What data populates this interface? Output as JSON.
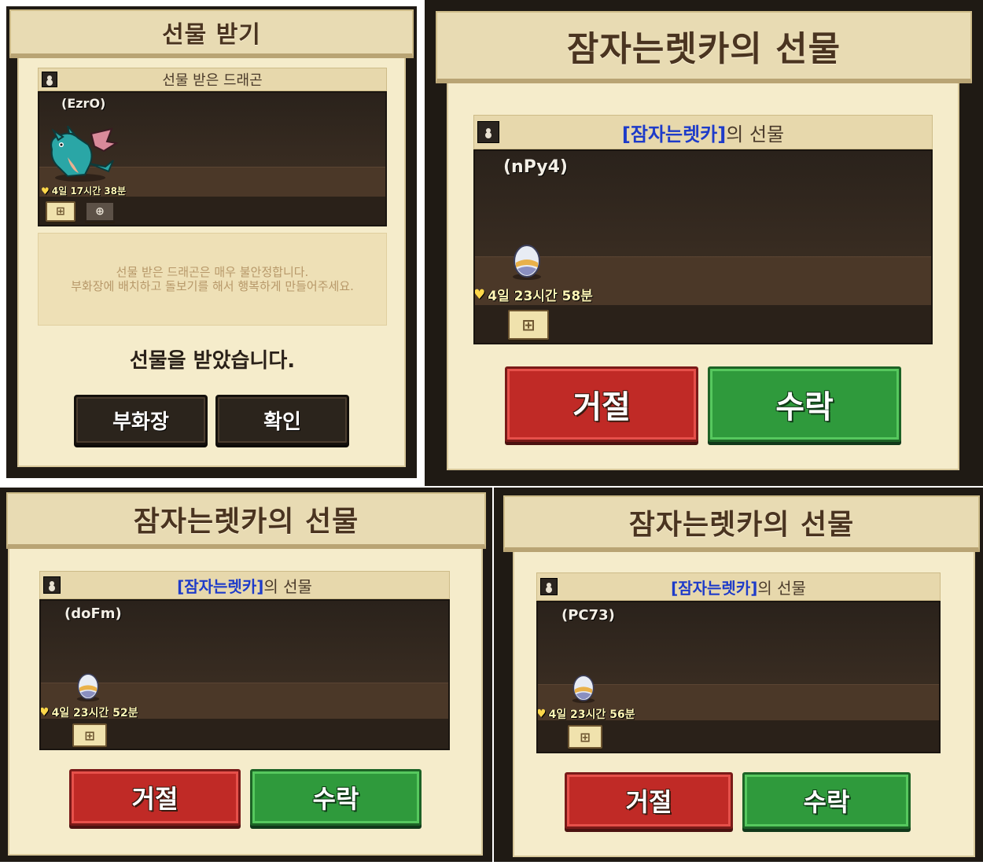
{
  "panels": {
    "receive": {
      "title": "선물 받기",
      "subheader": "선물 받은 드래곤",
      "tag": "(EzrO)",
      "timer": "4일 17시간 38분",
      "info_line1": "선물 받은 드래곤은 매우 불안정합니다.",
      "info_line2": "부화장에 배치하고 돌보기를 해서 행복하게 만들어주세요.",
      "message": "선물을 받았습니다.",
      "hatchery_label": "부화장",
      "confirm_label": "확인"
    },
    "gift1": {
      "title": "잠자는렛카의 선물",
      "sender": "[잠자는렛카]",
      "suffix": "의 선물",
      "tag": "(nPy4)",
      "timer": "4일 23시간 58분",
      "reject_label": "거절",
      "accept_label": "수락"
    },
    "gift2": {
      "title": "잠자는렛카의 선물",
      "sender": "[잠자는렛카]",
      "suffix": "의 선물",
      "tag": "(doFm)",
      "timer": "4일 23시간 52분",
      "reject_label": "거절",
      "accept_label": "수락"
    },
    "gift3": {
      "title": "잠자는렛카의 선물",
      "sender": "[잠자는렛카]",
      "suffix": "의 선물",
      "tag": "(PC73)",
      "timer": "4일 23시간 56분",
      "reject_label": "거절",
      "accept_label": "수락"
    }
  },
  "icons": {
    "heart": "heart-icon",
    "person": "person-icon",
    "nest": "nest-icon",
    "target": "target-icon",
    "egg": "egg-icon",
    "dragon": "dragon-icon"
  },
  "colors": {
    "sender_blue": "#1e3bc9",
    "reject_red": "#c02a26",
    "accept_green": "#2f9a3c",
    "paper": "#f5eccb"
  }
}
